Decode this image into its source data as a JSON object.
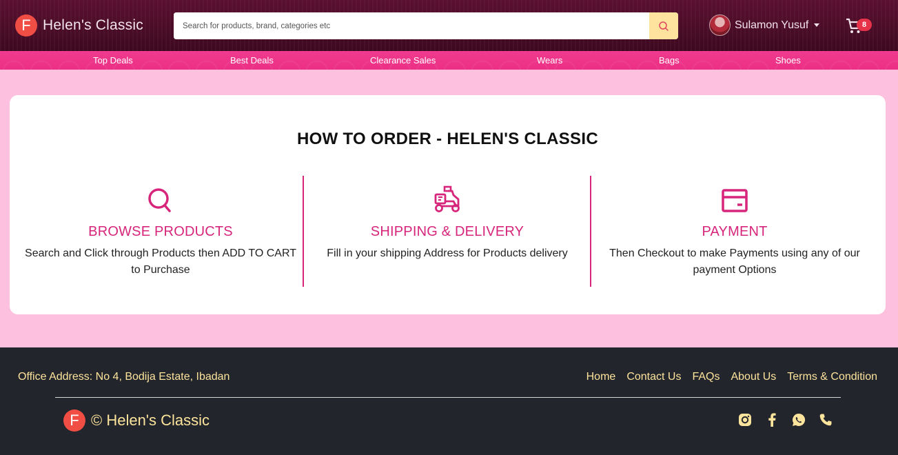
{
  "header": {
    "brand_logo_letter": "F",
    "brand_name": "Helen's Classic",
    "search_placeholder": "Search for products, brand, categories etc",
    "user_name": "Sulamon Yusuf",
    "cart_count": "8"
  },
  "nav": {
    "items": [
      {
        "label": "Top Deals"
      },
      {
        "label": "Best Deals"
      },
      {
        "label": "Clearance Sales"
      },
      {
        "label": "Wears"
      },
      {
        "label": "Bags"
      },
      {
        "label": "Shoes"
      }
    ]
  },
  "how_to_order": {
    "title": "HOW TO ORDER - HELEN'S CLASSIC",
    "steps": [
      {
        "icon": "search-icon",
        "title": "BROWSE PRODUCTS",
        "description": "Search and Click through Products then ADD TO CART to Purchase"
      },
      {
        "icon": "delivery-truck-icon",
        "title": "SHIPPING & DELIVERY",
        "description": "Fill in your shipping Address for Products delivery"
      },
      {
        "icon": "credit-card-icon",
        "title": "PAYMENT",
        "description": "Then Checkout to make Payments using any of our payment Options"
      }
    ]
  },
  "footer": {
    "address": "Office Address: No 4, Bodija Estate, Ibadan",
    "links": [
      {
        "label": "Home"
      },
      {
        "label": "Contact Us"
      },
      {
        "label": "FAQs"
      },
      {
        "label": "About Us"
      },
      {
        "label": "Terms & Condition"
      }
    ],
    "logo_letter": "F",
    "copyright": "© Helen's Classic",
    "social": [
      "instagram-icon",
      "facebook-icon",
      "whatsapp-icon",
      "phone-icon"
    ]
  },
  "colors": {
    "header_bg": "#4a0c27",
    "nav_bg": "#ef3b8f",
    "page_bg": "#fec0df",
    "accent": "#d6257a",
    "footer_bg": "#22252b",
    "footer_text": "#fde49c",
    "search_button_bg": "#fde39e",
    "badge": "#e6334a"
  }
}
